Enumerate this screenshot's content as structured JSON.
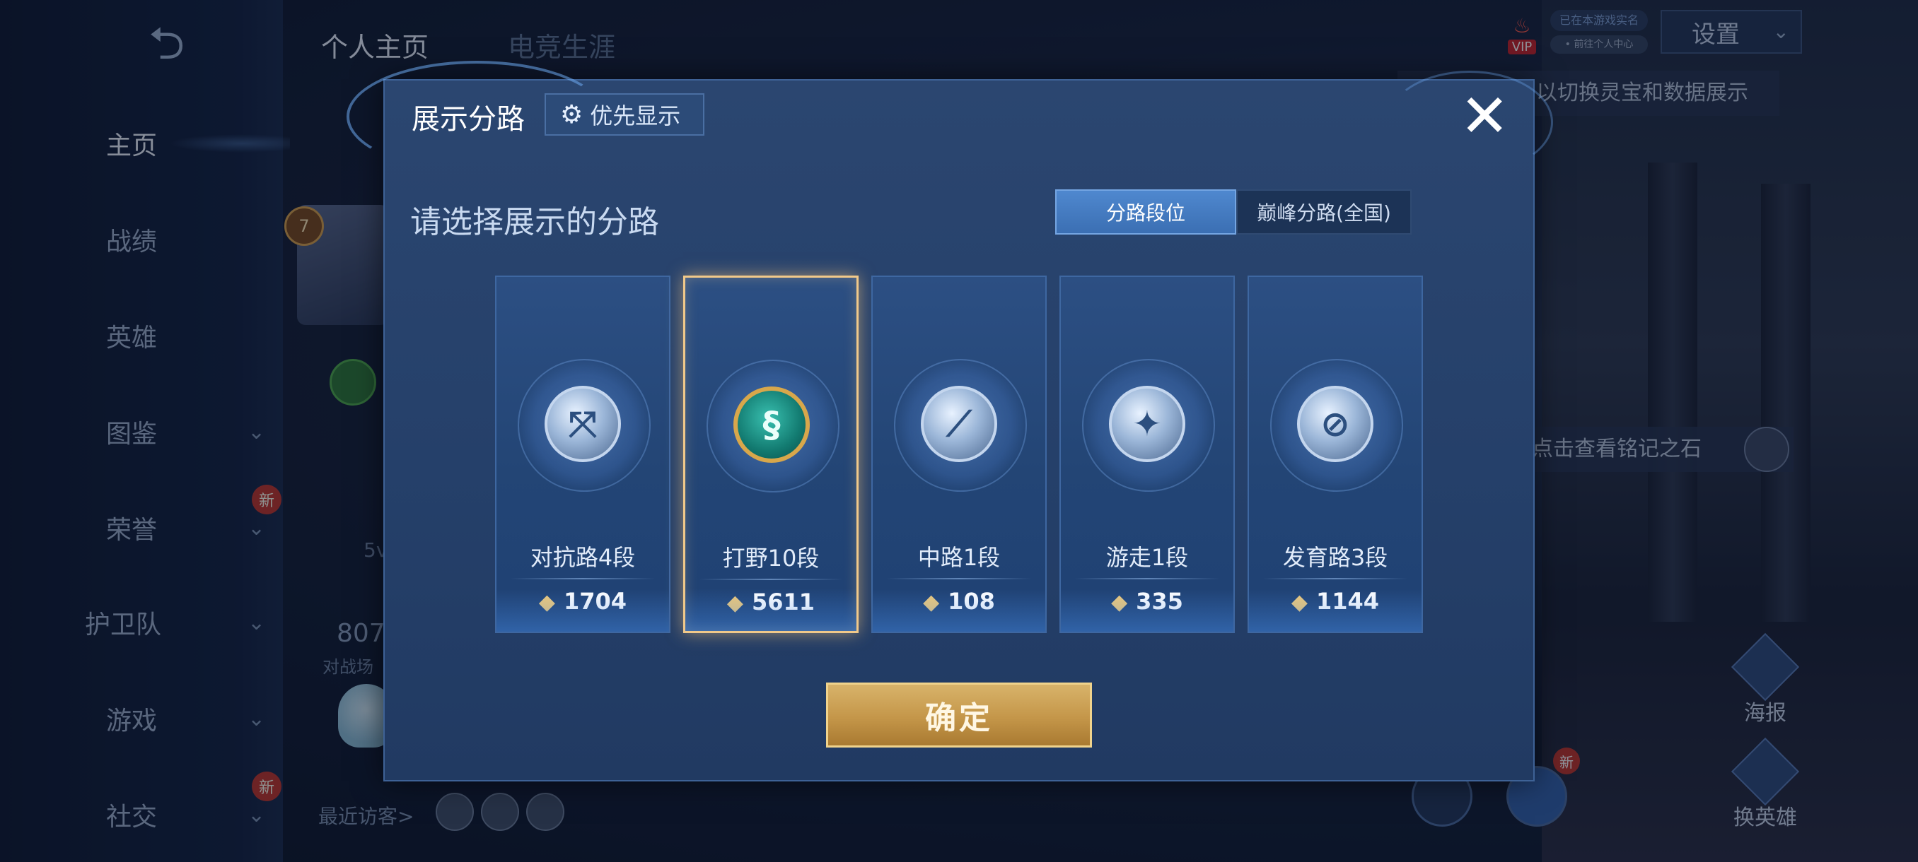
{
  "background": {
    "back_arrow": "⮌",
    "top_tabs": [
      "个人主页",
      "电竞生涯"
    ],
    "nav": [
      {
        "label": "主页",
        "active": true,
        "chevron": false,
        "badge": ""
      },
      {
        "label": "战绩",
        "chevron": false,
        "badge": ""
      },
      {
        "label": "英雄",
        "chevron": false,
        "badge": ""
      },
      {
        "label": "图鉴",
        "chevron": true,
        "badge": ""
      },
      {
        "label": "荣誉",
        "chevron": true,
        "badge": "新"
      },
      {
        "label": "护卫队",
        "chevron": true,
        "badge": ""
      },
      {
        "label": "游戏",
        "chevron": true,
        "badge": ""
      },
      {
        "label": "社交",
        "chevron": true,
        "badge": "新"
      }
    ],
    "chevron_glyph": "⌄",
    "level": "7",
    "left_text_5v": "5v",
    "left_number": "807",
    "left_sub": "对战场",
    "recent_visitors_label": "最近访客>",
    "vip_label": "VIP",
    "pill_top": "已在本游戏实名",
    "pill_bottom": "• 前往个人中心",
    "settings_label": "设置",
    "hint_top": "以切换灵宝和数据展示",
    "hint_inscription": "点击查看铭记之石",
    "side_buttons": [
      "海报",
      "换英雄"
    ],
    "new_badge": "新"
  },
  "dialog": {
    "title": "展示分路",
    "priority_button": "优先显示",
    "priority_icon": "gear-icon",
    "close_glyph": "✕",
    "subtitle": "请选择展示的分路",
    "segment": {
      "options": [
        "分路段位",
        "巅峰分路(全国)"
      ],
      "selected": 0
    },
    "cards": [
      {
        "lane": "对抗路4段",
        "score": "1704",
        "icon": "clash-lane-icon",
        "glyph": "⤧",
        "selected": false
      },
      {
        "lane": "打野10段",
        "score": "5611",
        "icon": "jungle-dragon-icon",
        "glyph": "§",
        "selected": true
      },
      {
        "lane": "中路1段",
        "score": "108",
        "icon": "mid-lane-icon",
        "glyph": "⟋",
        "selected": false
      },
      {
        "lane": "游走1段",
        "score": "335",
        "icon": "roam-wings-icon",
        "glyph": "✦",
        "selected": false
      },
      {
        "lane": "发育路3段",
        "score": "1144",
        "icon": "farm-lane-icon",
        "glyph": "⊘",
        "selected": false
      }
    ],
    "score_icon_glyph": "◆",
    "confirm_label": "确定"
  },
  "colors": {
    "dialog_bg": "#25406a",
    "selected_border": "#f1c98a",
    "confirm_gold": "#c49649",
    "segment_active": "#4f88cf"
  }
}
